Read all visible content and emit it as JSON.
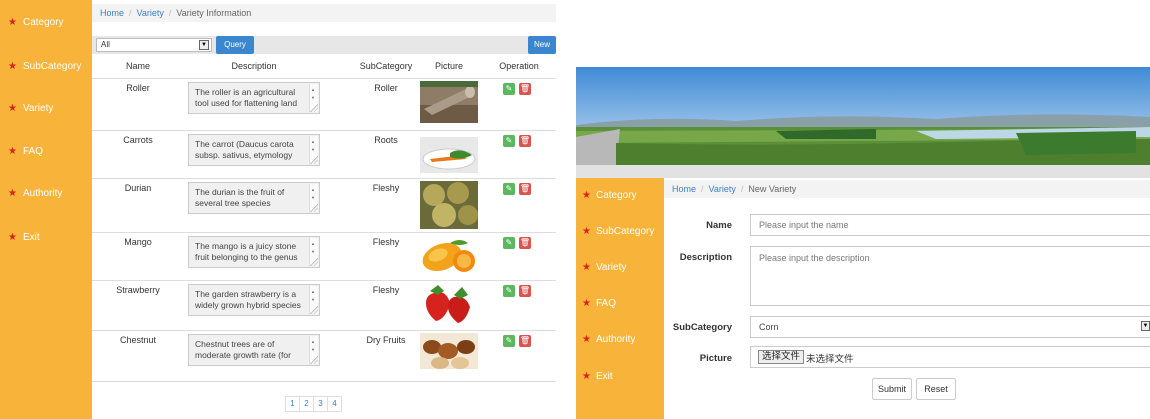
{
  "sidebar": {
    "items": [
      {
        "label": "Category"
      },
      {
        "label": "SubCategory"
      },
      {
        "label": "Variety"
      },
      {
        "label": "FAQ"
      },
      {
        "label": "Authority"
      },
      {
        "label": "Exit"
      }
    ]
  },
  "list_page": {
    "breadcrumb": {
      "home": "Home",
      "section": "Variety",
      "current": "Variety Information"
    },
    "filter": {
      "selected": "All"
    },
    "query_label": "Query",
    "new_label": "New",
    "columns": [
      "Name",
      "Description",
      "SubCategory",
      "Picture",
      "Operation"
    ],
    "rows": [
      {
        "name": "Roller",
        "description": "The roller is an agricultural tool used for flattening land",
        "subcategory": "Roller",
        "picture": "roller-photo"
      },
      {
        "name": "Carrots",
        "description": "The carrot (Daucus carota subsp. sativus, etymology",
        "subcategory": "Roots",
        "picture": "carrot-photo"
      },
      {
        "name": "Durian",
        "description": "The durian is the fruit of several tree species",
        "subcategory": "Fleshy",
        "picture": "durian-photo"
      },
      {
        "name": "Mango",
        "description": "The mango is a juicy stone fruit belonging to the genus",
        "subcategory": "Fleshy",
        "picture": "mango-photo"
      },
      {
        "name": "Strawberry",
        "description": "The garden strawberry is a widely grown hybrid species",
        "subcategory": "Fleshy",
        "picture": "strawberry-photo"
      },
      {
        "name": "Chestnut",
        "description": "Chestnut trees are of moderate growth rate (for",
        "subcategory": "Dry Fruits",
        "picture": "chestnut-photo"
      }
    ],
    "pages": [
      "1",
      "2",
      "3",
      "4"
    ]
  },
  "form_page": {
    "breadcrumb": {
      "home": "Home",
      "section": "Variety",
      "current": "New Variety"
    },
    "name_label": "Name",
    "name_placeholder": "Please input the name",
    "description_label": "Description",
    "description_placeholder": "Please input the description",
    "subcategory_label": "SubCategory",
    "subcategory_value": "Corn",
    "picture_label": "Picture",
    "file_button": "选择文件",
    "file_status": "未选择文件",
    "submit_label": "Submit",
    "reset_label": "Reset"
  },
  "colors": {
    "sidebar": "#f7b33a",
    "primary": "#3a86cf",
    "success": "#5cb85c",
    "danger": "#d9534f",
    "star": "#d9241e"
  },
  "icons": {
    "edit": "edit-icon",
    "delete": "trash-icon",
    "menu_bullet": "star-icon"
  }
}
